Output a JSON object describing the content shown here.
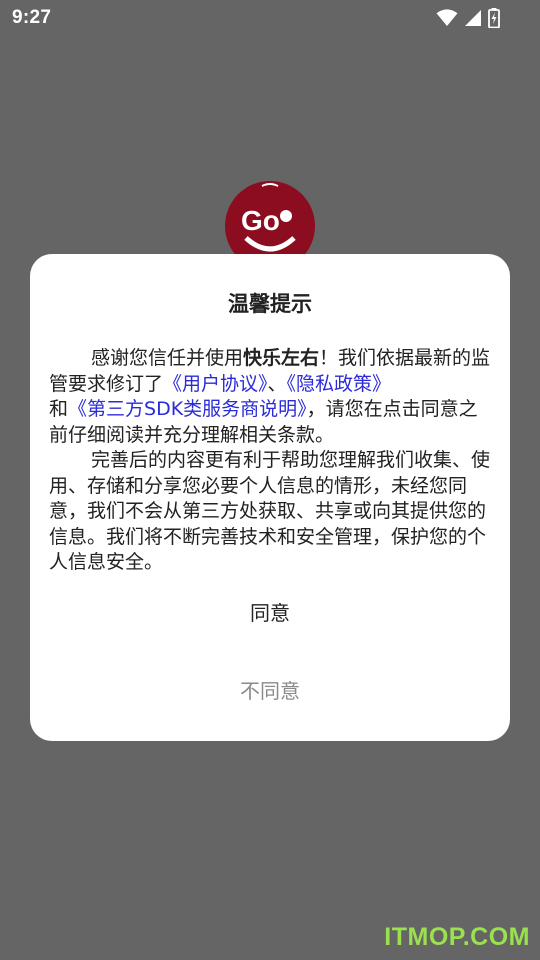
{
  "status_bar": {
    "time": "9:27",
    "icons": [
      "wifi-icon",
      "cellular-signal-icon",
      "battery-charging-icon"
    ],
    "color": "#ffffff"
  },
  "splash": {
    "logo": "app-logo",
    "logo_color": "#c8102e"
  },
  "dialog": {
    "title": "温馨提示",
    "paragraph1": {
      "prefix": "感谢您信任并使用",
      "brand": "快乐左右",
      "text1": "！我们依据最新的监管要求修订了",
      "link_user_agreement": "《用户协议》",
      "sep1": "、",
      "link_privacy_policy": "《隐私政策》",
      "text2": "和",
      "link_sdk_statement": "《第三方SDK类服务商说明》",
      "text3": "，请您在点击同意之前仔细阅读并充分理解相关条款。"
    },
    "paragraph2": "完善后的内容更有利于帮助您理解我们收集、使用、存储和分享您必要个人信息的情形，未经您同意，我们不会从第三方处获取、共享或向其提供您的信息。我们将不断完善技术和安全管理，保护您的个人信息安全。",
    "agree_label": "同意",
    "disagree_label": "不同意",
    "link_color": "#2b2bd9"
  },
  "overlay_color": "#656565",
  "watermark": "ITMOP.COM"
}
